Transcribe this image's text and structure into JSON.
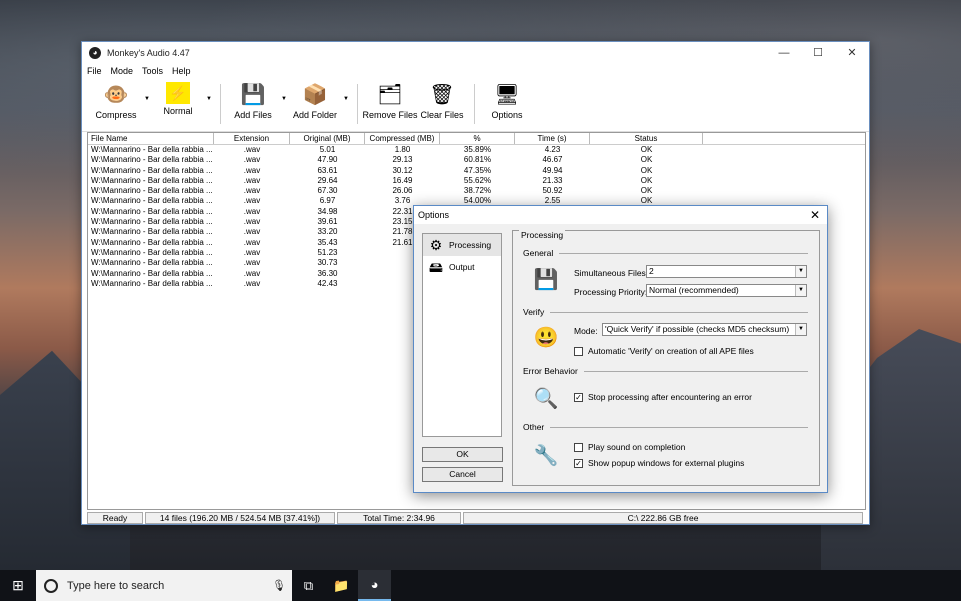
{
  "main_window": {
    "title": "Monkey's Audio 4.47",
    "menu": [
      "File",
      "Mode",
      "Tools",
      "Help"
    ],
    "toolbar": {
      "compress": "Compress",
      "normal": "Normal",
      "add_files": "Add Files",
      "add_folder": "Add Folder",
      "remove_files": "Remove Files",
      "clear_files": "Clear Files",
      "options": "Options"
    },
    "columns": [
      "File Name",
      "Extension",
      "Original (MB)",
      "Compressed (MB)",
      "%",
      "Time (s)",
      "Status"
    ],
    "rows": [
      [
        "W:\\Mannarino - Bar della rabbia ...",
        ".wav",
        "5.01",
        "1.80",
        "35.89%",
        "4.23",
        "OK"
      ],
      [
        "W:\\Mannarino - Bar della rabbia ...",
        ".wav",
        "47.90",
        "29.13",
        "60.81%",
        "46.67",
        "OK"
      ],
      [
        "W:\\Mannarino - Bar della rabbia ...",
        ".wav",
        "63.61",
        "30.12",
        "47.35%",
        "49.94",
        "OK"
      ],
      [
        "W:\\Mannarino - Bar della rabbia ...",
        ".wav",
        "29.64",
        "16.49",
        "55.62%",
        "21.33",
        "OK"
      ],
      [
        "W:\\Mannarino - Bar della rabbia ...",
        ".wav",
        "67.30",
        "26.06",
        "38.72%",
        "50.92",
        "OK"
      ],
      [
        "W:\\Mannarino - Bar della rabbia ...",
        ".wav",
        "6.97",
        "3.76",
        "54.00%",
        "2.55",
        "OK"
      ],
      [
        "W:\\Mannarino - Bar della rabbia ...",
        ".wav",
        "34.98",
        "22.31",
        "",
        "",
        ""
      ],
      [
        "W:\\Mannarino - Bar della rabbia ...",
        ".wav",
        "39.61",
        "23.15",
        "",
        "",
        ""
      ],
      [
        "W:\\Mannarino - Bar della rabbia ...",
        ".wav",
        "33.20",
        "21.78",
        "",
        "",
        ""
      ],
      [
        "W:\\Mannarino - Bar della rabbia ...",
        ".wav",
        "35.43",
        "21.61",
        "",
        "",
        ""
      ],
      [
        "W:\\Mannarino - Bar della rabbia ...",
        ".wav",
        "51.23",
        "",
        "",
        "",
        ""
      ],
      [
        "W:\\Mannarino - Bar della rabbia ...",
        ".wav",
        "30.73",
        "",
        "",
        "",
        ""
      ],
      [
        "W:\\Mannarino - Bar della rabbia ...",
        ".wav",
        "36.30",
        "",
        "",
        "",
        ""
      ],
      [
        "W:\\Mannarino - Bar della rabbia ...",
        ".wav",
        "42.43",
        "",
        "",
        "",
        ""
      ]
    ],
    "status": {
      "state": "Ready",
      "files": "14 files (196.20 MB / 524.54 MB [37.41%])",
      "total_time": "Total Time: 2:34.96",
      "free": "C:\\ 222.86 GB free"
    }
  },
  "dialog": {
    "title": "Options",
    "nav": [
      "Processing",
      "Output"
    ],
    "ok": "OK",
    "cancel": "Cancel",
    "panel_title": "Processing",
    "general": {
      "label": "General",
      "sim_files_label": "Simultaneous Files:",
      "sim_files_value": "2",
      "priority_label": "Processing Priority:",
      "priority_value": "Normal (recommended)"
    },
    "verify": {
      "label": "Verify",
      "mode_label": "Mode:",
      "mode_value": "'Quick Verify' if possible (checks MD5 checksum)",
      "auto_verify": "Automatic 'Verify' on creation of all APE files",
      "auto_verify_checked": false
    },
    "error": {
      "label": "Error Behavior",
      "stop": "Stop processing after encountering an error",
      "stop_checked": true
    },
    "other": {
      "label": "Other",
      "sound": "Play sound on completion",
      "sound_checked": false,
      "popup": "Show popup windows for external plugins",
      "popup_checked": true
    }
  },
  "taskbar": {
    "search_placeholder": "Type here to search"
  }
}
